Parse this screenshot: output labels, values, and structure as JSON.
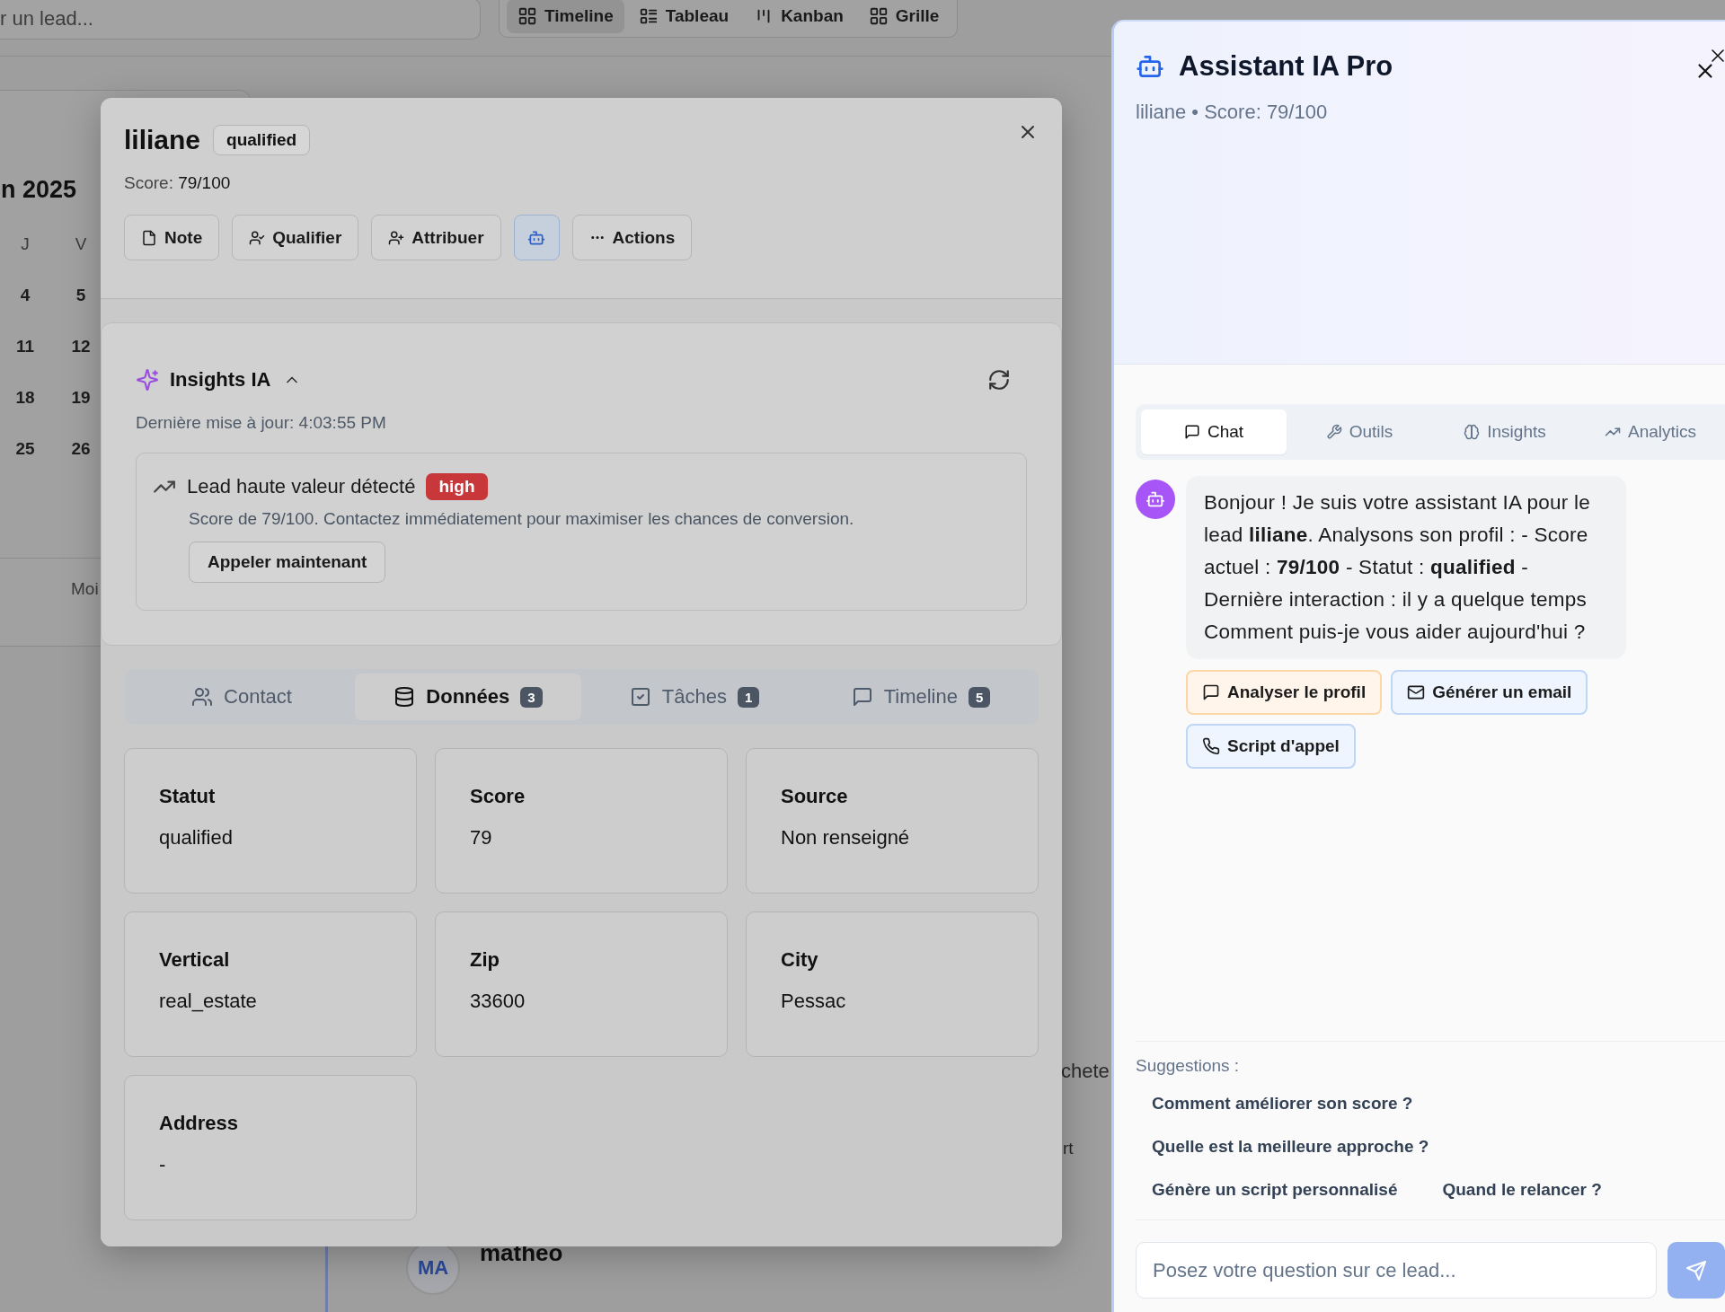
{
  "background": {
    "search": {
      "placeholder": "r un lead..."
    },
    "views": [
      {
        "label": "Timeline",
        "selected": true
      },
      {
        "label": "Tableau",
        "selected": false
      },
      {
        "label": "Kanban",
        "selected": false
      },
      {
        "label": "Grille",
        "selected": false
      }
    ],
    "calendar": {
      "title": "n 2025",
      "weekdays": [
        "J",
        "V"
      ],
      "weeks": [
        [
          "4",
          "5"
        ],
        [
          "11",
          "12"
        ],
        [
          "18",
          "19"
        ],
        [
          "25",
          "26"
        ]
      ],
      "footer": "Moi"
    },
    "fragments": [
      "chete",
      "rt"
    ],
    "lead": {
      "initials": "MA",
      "name": "matheo"
    }
  },
  "modal": {
    "name": "liliane",
    "status": "qualified",
    "score_label": "Score:",
    "score": "79/100",
    "actions": [
      {
        "label": "Note",
        "active": false
      },
      {
        "label": "Qualifier",
        "active": false
      },
      {
        "label": "Attribuer",
        "active": false
      },
      {
        "kind": "icon",
        "active": true
      },
      {
        "label": "Actions",
        "active": false
      }
    ],
    "insights": {
      "title": "Insights IA",
      "expanded": true,
      "updated": "Dernière mise à jour: 4:03:55 PM",
      "items": [
        {
          "title": "Lead haute valeur détecté",
          "priority": "high",
          "description": "Score de 79/100. Contactez immédiatement pour maximiser les chances de conversion.",
          "action": "Appeler maintenant"
        }
      ]
    },
    "tabs": [
      {
        "label": "Contact",
        "selected": false
      },
      {
        "label": "Données",
        "count": "3",
        "selected": true
      },
      {
        "label": "Tâches",
        "count": "1",
        "selected": false
      },
      {
        "label": "Timeline",
        "count": "5",
        "selected": false
      }
    ],
    "fields": [
      {
        "label": "Statut",
        "value": "qualified"
      },
      {
        "label": "Score",
        "value": "79"
      },
      {
        "label": "Source",
        "value": "Non renseigné"
      },
      {
        "label": "Vertical",
        "value": "real_estate"
      },
      {
        "label": "Zip",
        "value": "33600"
      },
      {
        "label": "City",
        "value": "Pessac"
      },
      {
        "label": "Address",
        "value": "-"
      }
    ]
  },
  "assistant": {
    "title": "Assistant IA Pro",
    "subtitle": "liliane • Score: 79/100",
    "tabs": [
      {
        "label": "Chat",
        "selected": true
      },
      {
        "label": "Outils",
        "selected": false
      },
      {
        "label": "Insights",
        "selected": false
      },
      {
        "label": "Analytics",
        "selected": false
      }
    ],
    "messages": [
      {
        "text": "Bonjour ! Je suis votre assistant IA pour le lead **liliane**. Analysons son profil : - Score actuel : **79/100** - Statut : **qualified** - Dernière interaction : il y a quelque temps Comment puis-je vous aider aujourd'hui ?"
      }
    ],
    "quick_actions": [
      {
        "label": "Analyser le profil",
        "kind": "accent"
      },
      {
        "label": "Générer un email",
        "kind": "default"
      },
      {
        "label": "Script d'appel",
        "kind": "default"
      }
    ],
    "suggestions_title": "Suggestions :",
    "suggestions": [
      "Comment améliorer son score ?",
      "Quelle est la meilleure approche ?",
      "Génère un script personnalisé",
      "Quand le relancer ?"
    ],
    "input": {
      "placeholder": "Posez votre question sur ce lead..."
    },
    "send_disabled": true
  }
}
